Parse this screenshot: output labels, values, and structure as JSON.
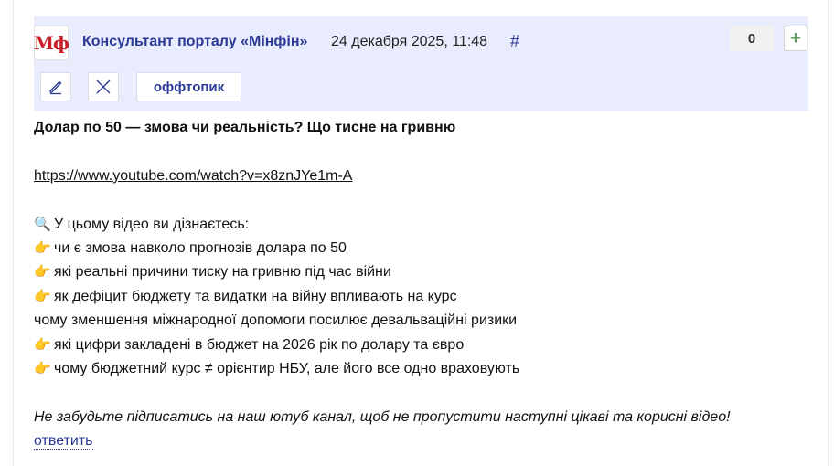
{
  "post": {
    "avatar_text": "Мф",
    "author": "Консультант порталу «Мінфін»",
    "date": "24 декабря 2025, 11:48",
    "hash": "#",
    "score": "0",
    "plus": "+",
    "tag": "оффтопик",
    "title": "Долар по 50 — змова чи реальність? Що тисне на гривню",
    "link": "https://www.youtube.com/watch?v=x8znJYe1m-A",
    "intro_icon": "🔍",
    "intro": "У цьому відео ви дізнаєтесь:",
    "bullet_icon": "👉",
    "bullets": [
      "чи є змова навколо прогнозів долара по 50",
      "які реальні причини тиску на гривню під час війни",
      "як дефіцит бюджету та видатки на війну впливають на курс"
    ],
    "plain_line": "чому зменшення міжнародної допомоги посилює девальваційні ризики",
    "bullets2": [
      "які цифри закладені в бюджет на 2026 рік по долару та євро",
      "чому бюджетний курс ≠ орієнтир НБУ, але його все одно враховують"
    ],
    "footer": "Не забудьте підписатись на наш ютуб канал, щоб не пропустити наступні цікаві та корисні відео!",
    "reply": "ответить"
  },
  "colors": {
    "header_bg": "#e8ecfc",
    "accent": "#2b3a94",
    "logo_red": "#c8202a",
    "plus_green": "#58a35a"
  },
  "icons": {
    "edit": "pencil-icon",
    "close": "close-icon",
    "plus": "plus-icon"
  }
}
